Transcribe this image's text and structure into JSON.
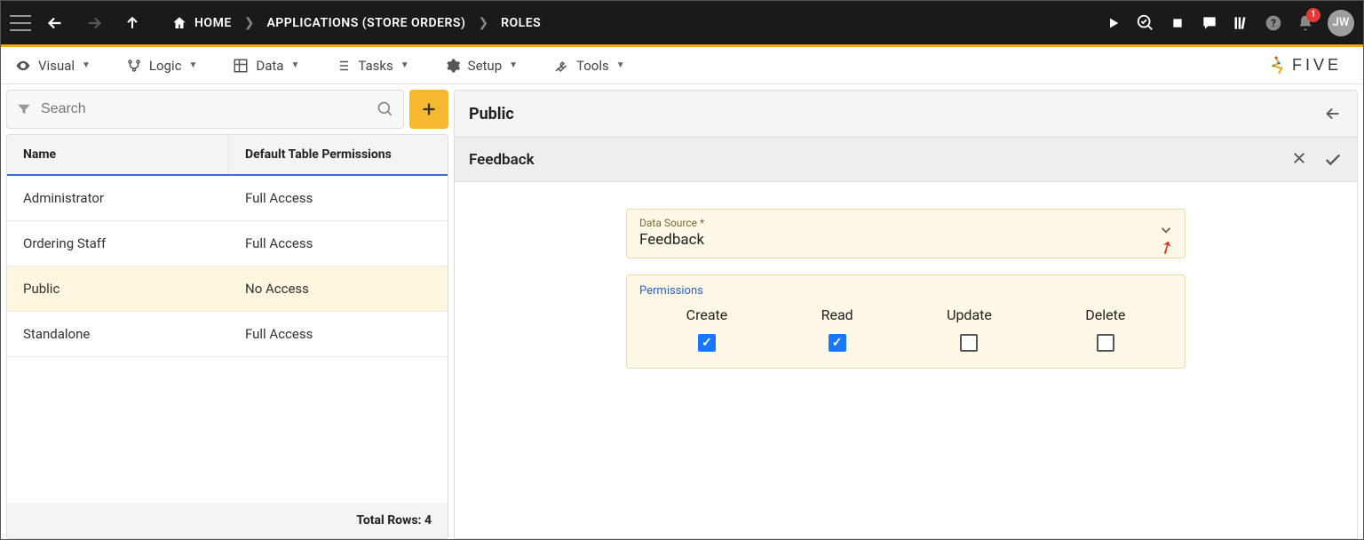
{
  "topbar": {
    "breadcrumbs": [
      {
        "label": "HOME",
        "icon": "home"
      },
      {
        "label": "APPLICATIONS (STORE ORDERS)"
      },
      {
        "label": "ROLES"
      }
    ],
    "notif_count": "1",
    "avatar_initials": "JW"
  },
  "menubar": {
    "items": [
      {
        "label": "Visual",
        "icon": "eye"
      },
      {
        "label": "Logic",
        "icon": "branch"
      },
      {
        "label": "Data",
        "icon": "grid"
      },
      {
        "label": "Tasks",
        "icon": "list"
      },
      {
        "label": "Setup",
        "icon": "gear"
      },
      {
        "label": "Tools",
        "icon": "wrench"
      }
    ],
    "brand": "FIVE"
  },
  "left": {
    "search_placeholder": "Search",
    "columns": {
      "name": "Name",
      "perm": "Default Table Permissions"
    },
    "rows": [
      {
        "name": "Administrator",
        "perm": "Full Access",
        "selected": false
      },
      {
        "name": "Ordering Staff",
        "perm": "Full Access",
        "selected": false
      },
      {
        "name": "Public",
        "perm": "No Access",
        "selected": true
      },
      {
        "name": "Standalone",
        "perm": "Full Access",
        "selected": false
      }
    ],
    "footer": "Total Rows: 4"
  },
  "right": {
    "header_title": "Public",
    "sub_title": "Feedback",
    "field": {
      "label": "Data Source *",
      "value": "Feedback"
    },
    "perms_label": "Permissions",
    "perms": [
      {
        "name": "Create",
        "checked": true
      },
      {
        "name": "Read",
        "checked": true
      },
      {
        "name": "Update",
        "checked": false
      },
      {
        "name": "Delete",
        "checked": false
      }
    ]
  }
}
